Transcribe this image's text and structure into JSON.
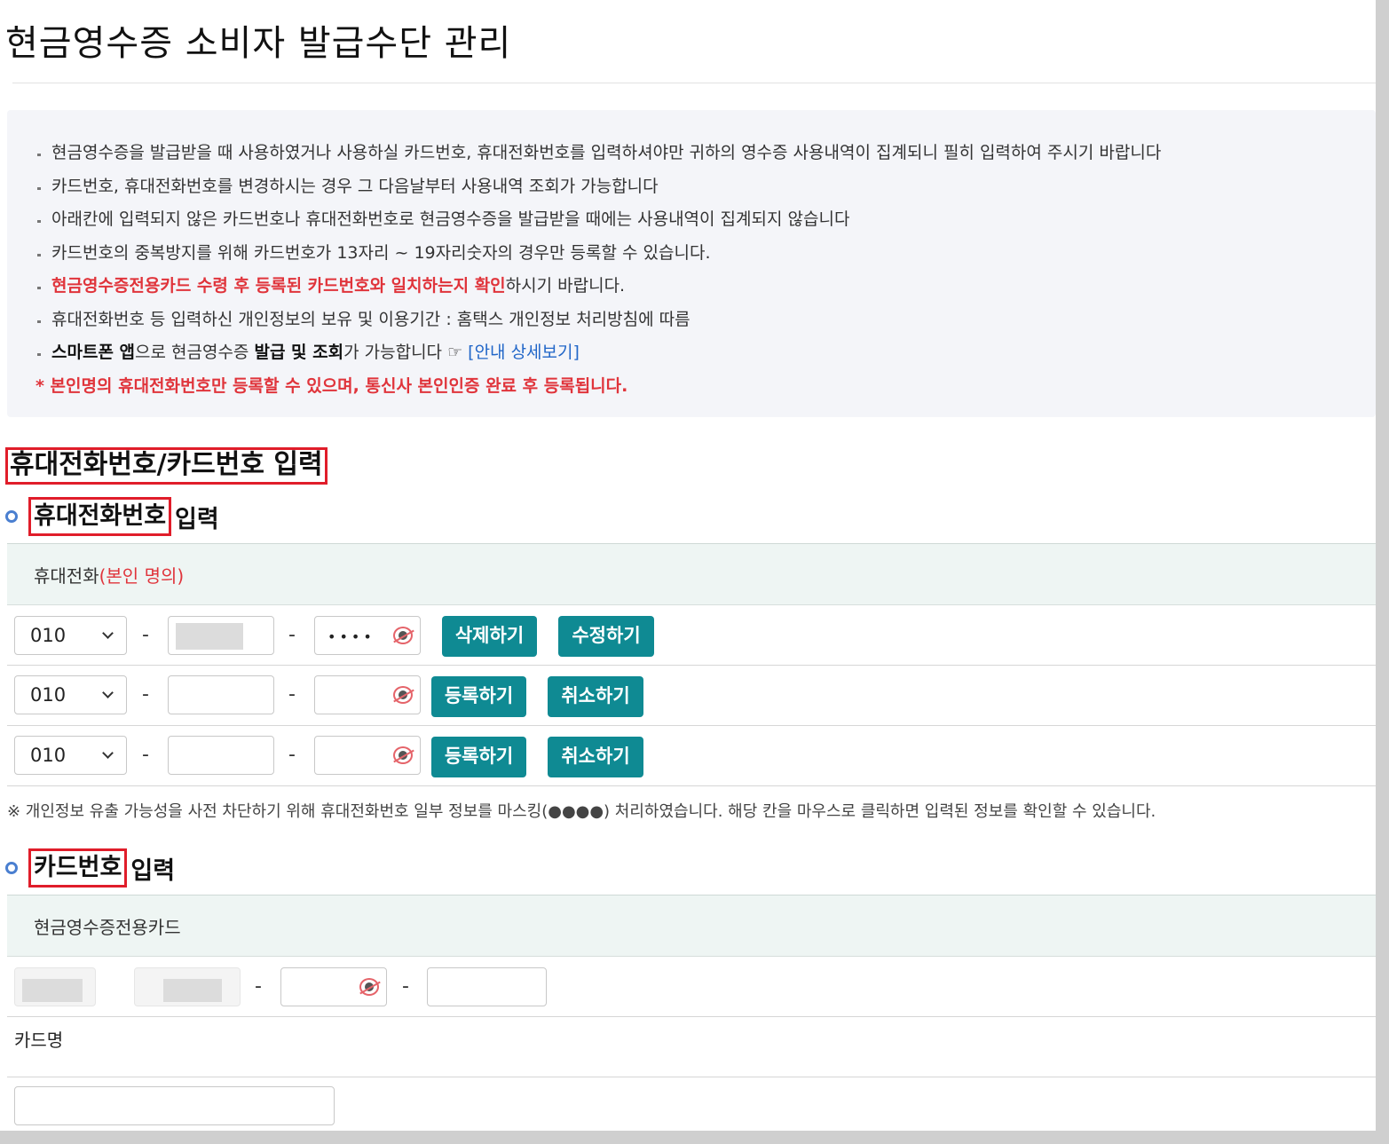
{
  "page_title": "현금영수증 소비자 발급수단 관리",
  "notices": [
    {
      "text": "현금영수증을 발급받을 때 사용하였거나 사용하실 카드번호, 휴대전화번호를 입력하셔야만 귀하의 영수증 사용내역이 집계되니 필히 입력하여 주시기 바랍니다"
    },
    {
      "text": "카드번호, 휴대전화번호를 변경하시는 경우 그 다음날부터 사용내역 조회가 가능합니다"
    },
    {
      "text": "아래칸에 입력되지 않은 카드번호나 휴대전화번호로 현금영수증을 발급받을 때에는 사용내역이 집계되지 않습니다"
    },
    {
      "text": "카드번호의 중복방지를 위해 카드번호가 13자리 ~ 19자리숫자의 경우만 등록할 수 있습니다."
    },
    {
      "red_part": "현금영수증전용카드 수령 후 등록된 카드번호와 일치하는지 확인",
      "rest": "하시기 바랍니다."
    },
    {
      "text": "휴대전화번호 등 입력하신 개인정보의 보유 및 이용기간 : 홈택스 개인정보 처리방침에 따름"
    },
    {
      "bold1": "스마트폰 앱",
      "t1": "으로 현금영수증 ",
      "bold2": "발급 및 조회",
      "t2": "가 가능합니다 ☞ ",
      "link": "[안내 상세보기]"
    },
    {
      "text": "* 본인명의 휴대전화번호만 등록할 수 있으며, 통신사 본인인증 완료 후 등록됩니다."
    }
  ],
  "section_title": "휴대전화번호/카드번호 입력",
  "phone_section": {
    "title_boxed": "휴대전화번호",
    "title_rest": "입력",
    "header_label": "휴대전화",
    "header_red": "(본인 명의)",
    "rows": [
      {
        "prefix": "010",
        "middle": "",
        "last": "••••",
        "btn1": "삭제하기",
        "btn2": "수정하기"
      },
      {
        "prefix": "010",
        "middle": "",
        "last": "",
        "btn1": "등록하기",
        "btn2": "취소하기"
      },
      {
        "prefix": "010",
        "middle": "",
        "last": "",
        "btn1": "등록하기",
        "btn2": "취소하기"
      }
    ],
    "dash": "-"
  },
  "mask_note": "※ 개인정보 유출 가능성을 사전 차단하기 위해 휴대전화번호 일부 정보를 마스킹(●●●●) 처리하였습니다. 해당 칸을 마우스로 클릭하면 입력된 정보를 확인할 수 있습니다.",
  "card_section": {
    "title_boxed": "카드번호",
    "title_rest": "입력",
    "header_label": "현금영수증전용카드",
    "card_name_label": "카드명",
    "card_name_value": ""
  },
  "colors": {
    "accent_teal": "#0f8a93",
    "alert_red": "#e0343b",
    "highlight_box": "#e01d2a",
    "link_blue": "#2166c8"
  }
}
